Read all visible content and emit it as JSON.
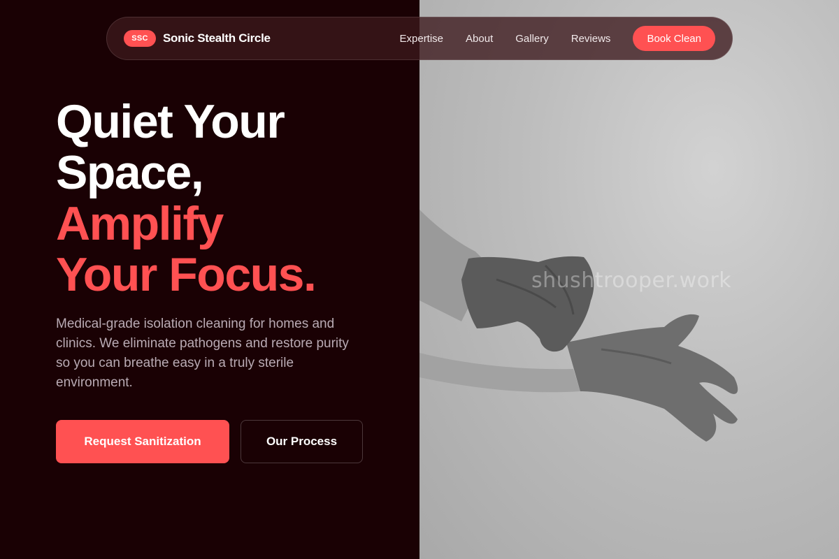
{
  "nav": {
    "badge": "SSC",
    "brand_name": "Sonic Stealth Circle",
    "links": [
      "Expertise",
      "About",
      "Gallery",
      "Reviews"
    ],
    "cta": "Book Clean"
  },
  "hero": {
    "title_line_1": "Quiet Your",
    "title_line_2": "Space,",
    "title_line_3": "Amplify",
    "title_line_4": "Your Focus.",
    "description": "Medical-grade isolation cleaning for homes and clinics. We eliminate pathogens and restore purity so you can breathe easy in a truly sterile environment.",
    "primary_button": "Request Sanitization",
    "secondary_button": "Our Process"
  },
  "image": {
    "watermark": "shushtrooper.work",
    "subject": "gloved-hands-image"
  },
  "colors": {
    "background": "#1a0104",
    "accent": "#ff5152",
    "text_muted": "#b9abb4"
  }
}
